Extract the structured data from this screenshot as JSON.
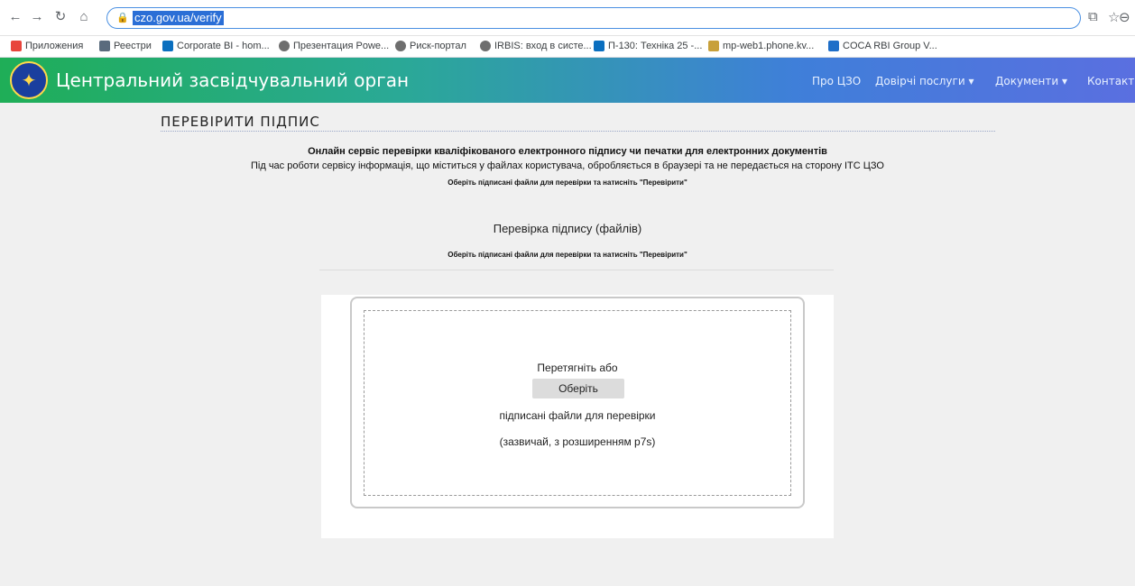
{
  "browser": {
    "url": "czo.gov.ua/verify",
    "bookmarks": [
      {
        "label": "Приложения",
        "color": "#e8453c"
      },
      {
        "label": "Реестри",
        "color": "#5a6b7d"
      },
      {
        "label": "Corporate BI - hom...",
        "color": "#0b6fbf"
      },
      {
        "label": "Презентация Powe...",
        "color": "#6e6e6e"
      },
      {
        "label": "Риск-портал",
        "color": "#6e6e6e"
      },
      {
        "label": "IRBIS: вход в систе...",
        "color": "#6e6e6e"
      },
      {
        "label": "П-130: Техніка 25 -...",
        "color": "#0b6fbf"
      },
      {
        "label": "mp-web1.phone.kv...",
        "color": "#c8a03a"
      },
      {
        "label": "COCA RBI Group V...",
        "color": "#1e6ec8"
      }
    ]
  },
  "site": {
    "title": "Центральний засвідчувальний орган",
    "nav": [
      "Про ЦЗО",
      "Довірчі послуги ▾",
      "Документи ▾",
      "Контакти"
    ]
  },
  "page": {
    "title": "ПЕРЕВІРИТИ ПІДПИС",
    "line1": "Онлайн сервіс перевірки кваліфікованого електронного підпису чи печатки для електронних документів",
    "line2": "Під час роботи сервісу інформація, що міститься у файлах користувача, обробляється в браузері та не передається на сторону ІТС ЦЗО",
    "line3": "Оберіть підписані файли для перевірки та натисніть \"Перевірити\"",
    "subtitle": "Перевірка підпису (файлів)",
    "instruction": "Оберіть підписані файли для перевірки та натисніть \"Перевірити\""
  },
  "dropzone": {
    "drag_text": "Перетягніть або",
    "button_label": "Оберіть",
    "files_text": "підписані файли для перевірки",
    "ext_text": "(зазвичай, з розширенням p7s)"
  }
}
